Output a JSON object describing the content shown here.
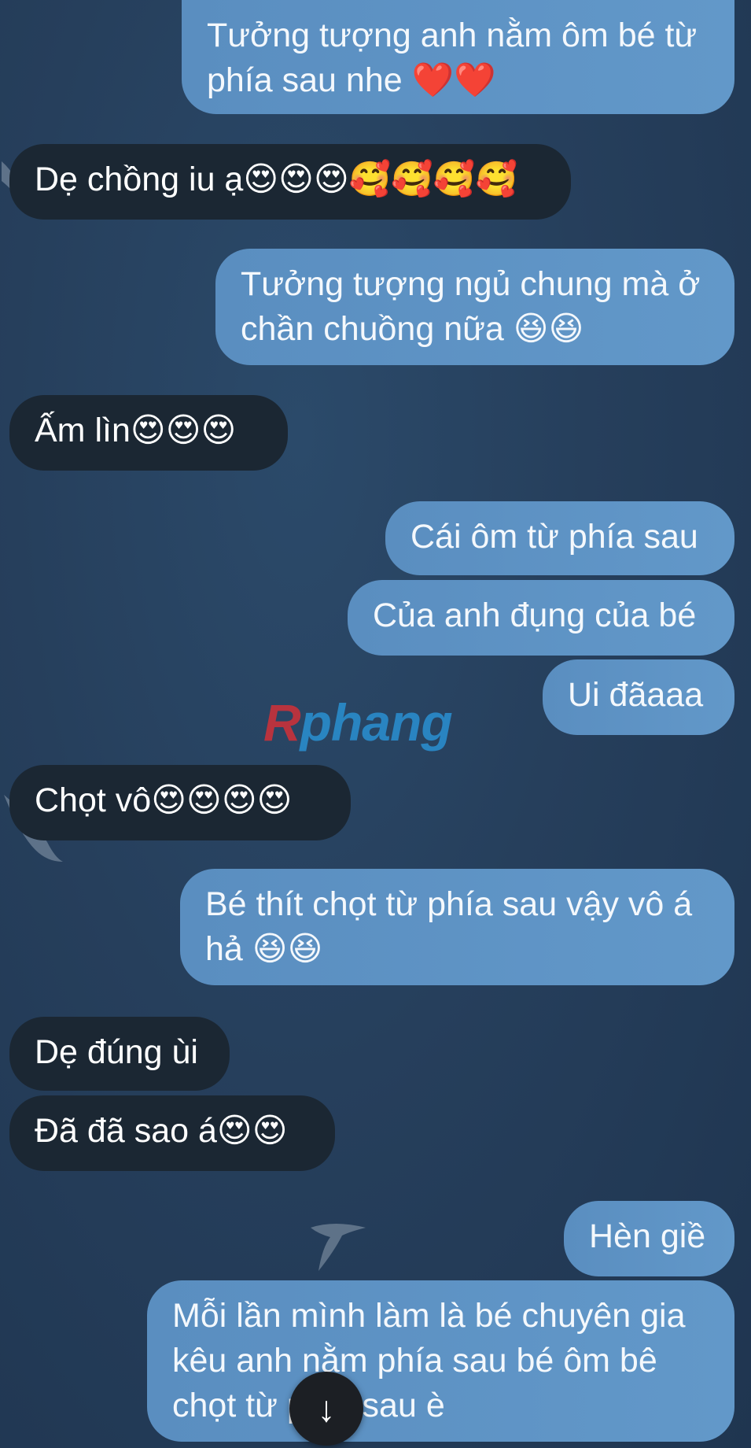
{
  "messages": [
    {
      "dir": "out",
      "text": "Tưởng tượng anh nằm ôm bé từ\nphía sau nhe ❤️❤️"
    },
    {
      "dir": "in",
      "text": "Dẹ chồng iu ạ😍😍😍🥰🥰🥰🥰"
    },
    {
      "dir": "out",
      "text": "Tưởng tượng ngủ chung mà ở\nchần chuồng nữa 😆😆"
    },
    {
      "dir": "in",
      "text": "Ấm lìn😍😍😍"
    },
    {
      "dir": "out",
      "text": "Cái ôm từ phía sau"
    },
    {
      "dir": "out",
      "text": "Của anh đụng của bé"
    },
    {
      "dir": "out",
      "text": "Ui đãaaa"
    },
    {
      "dir": "in",
      "text": "Chọt vô😍😍😍😍"
    },
    {
      "dir": "out",
      "text": "Bé thít chọt từ phía sau vậy vô á\nhả 😆😆"
    },
    {
      "dir": "in",
      "text": "Dẹ đúng ùi"
    },
    {
      "dir": "in",
      "text": "Đã đã sao á😍😍"
    },
    {
      "dir": "out",
      "text": "Hèn giề"
    },
    {
      "dir": "out",
      "text": "Mỗi lần mình làm là bé chuyên gia\nkêu anh nằm phía sau bé ôm bê\nchọt từ phía sau è"
    }
  ],
  "watermark": {
    "first": "R",
    "rest": "phang"
  },
  "scroll_button": {
    "icon": "arrow-down-icon",
    "glyph": "↓"
  },
  "colors": {
    "outgoing_bubble": "#5e93c5",
    "incoming_bubble": "#1b2733",
    "background": "#263f5c"
  }
}
